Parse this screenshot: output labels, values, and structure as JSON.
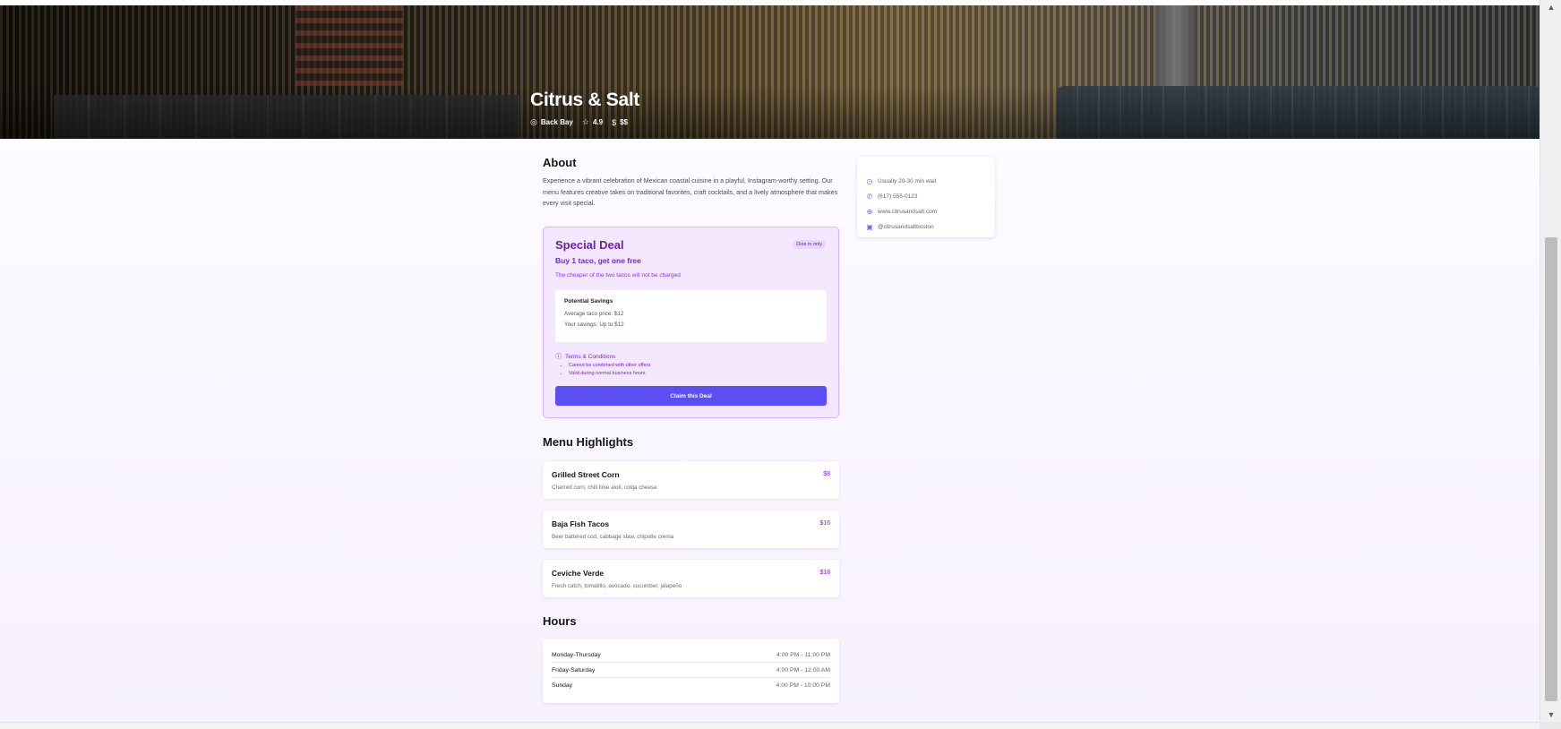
{
  "restaurant": {
    "name": "Citrus & Salt",
    "neighborhood": "Back Bay",
    "rating": "4.9",
    "price_level": "$$"
  },
  "about": {
    "title": "About",
    "text": "Experience a vibrant celebration of Mexican coastal cuisine in a playful, Instagram-worthy setting. Our menu features creative takes on traditional favorites, craft cocktails, and a lively atmosphere that makes every visit special."
  },
  "info": {
    "wait": "Usually 20-30 min wait",
    "phone": "(617) 555-0123",
    "website": "www.citrusandsalt.com",
    "instagram": "@citrusandsaltboston"
  },
  "deal": {
    "title": "Special Deal",
    "badge": "Dine in only",
    "headline": "Buy 1 taco, get one free",
    "description": "The cheaper of the two tacos will not be charged",
    "savings_title": "Potential Savings",
    "avg_price": "Average taco price: $12",
    "your_savings": "Your savings: Up to $12",
    "terms_label": "Terms & Conditions",
    "terms": [
      "Cannot be combined with other offers",
      "Valid during normal business hours"
    ],
    "button": "Claim this Deal"
  },
  "menu": {
    "title": "Menu Highlights",
    "items": [
      {
        "name": "Grilled Street Corn",
        "price": "$8",
        "description": "Charred corn, chili lime aioli, cotija cheese"
      },
      {
        "name": "Baja Fish Tacos",
        "price": "$16",
        "description": "Beer battered cod, cabbage slaw, chipotle crema"
      },
      {
        "name": "Ceviche Verde",
        "price": "$18",
        "description": "Fresh catch, tomatillo, avocado, cucumber, jalapeño"
      }
    ]
  },
  "hours": {
    "title": "Hours",
    "rows": [
      {
        "day": "Monday-Thursday",
        "time": "4:00 PM - 11:00 PM"
      },
      {
        "day": "Friday-Saturday",
        "time": "4:00 PM - 12:00 AM"
      },
      {
        "day": "Sunday",
        "time": "4:00 PM - 10:00 PM"
      }
    ]
  },
  "icons": {
    "location": "location-pin-icon",
    "rating": "star-icon",
    "price": "dollar-icon",
    "clock": "clock-icon",
    "phone": "phone-icon",
    "website": "globe-icon",
    "instagram": "instagram-icon",
    "terms": "info-icon"
  },
  "colors": {
    "accent": "#5b4ef5",
    "deal_bg": "#f3e8ff",
    "deal_text": "#7e22ce"
  }
}
